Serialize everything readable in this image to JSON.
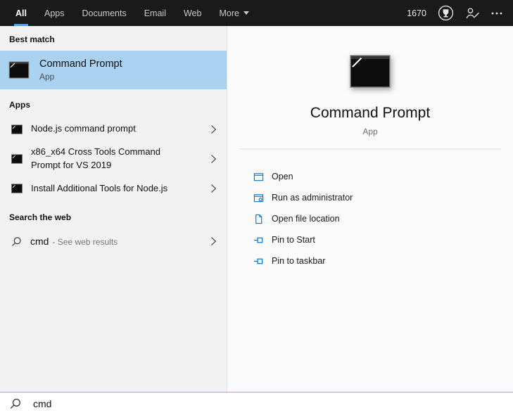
{
  "colors": {
    "topbar_bg": "#1a1a1a",
    "accent_blue": "#0078d7",
    "tab_underline": "#5ba0e0",
    "best_match_highlight": "#a8d2ef",
    "left_panel_bg": "#f2f2f2",
    "right_panel_bg": "#fafafa"
  },
  "topbar": {
    "tabs": [
      {
        "label": "All",
        "active": true
      },
      {
        "label": "Apps",
        "active": false
      },
      {
        "label": "Documents",
        "active": false
      },
      {
        "label": "Email",
        "active": false
      },
      {
        "label": "Web",
        "active": false
      },
      {
        "label": "More",
        "active": false,
        "has_dropdown": true
      }
    ],
    "points": "1670",
    "icons": [
      "rewards-icon",
      "feedback-icon",
      "more-options-icon"
    ]
  },
  "left_panel": {
    "best_match_header": "Best match",
    "best_match": {
      "title": "Command Prompt",
      "subtitle": "App",
      "icon": "command-prompt-icon"
    },
    "apps_header": "Apps",
    "apps": [
      {
        "label": "Node.js command prompt",
        "icon": "command-prompt-icon"
      },
      {
        "label": "x86_x64 Cross Tools Command Prompt for VS 2019",
        "icon": "command-prompt-icon"
      },
      {
        "label": "Install Additional Tools for Node.js",
        "icon": "command-prompt-icon"
      }
    ],
    "web_header": "Search the web",
    "web_item": {
      "query": "cmd",
      "suffix": "- See web results",
      "icon": "search-icon"
    }
  },
  "right_panel": {
    "title": "Command Prompt",
    "subtitle": "App",
    "icon": "command-prompt-icon",
    "actions": [
      {
        "label": "Open",
        "icon": "open-icon"
      },
      {
        "label": "Run as administrator",
        "icon": "run-as-admin-icon"
      },
      {
        "label": "Open file location",
        "icon": "file-location-icon"
      },
      {
        "label": "Pin to Start",
        "icon": "pin-icon"
      },
      {
        "label": "Pin to taskbar",
        "icon": "pin-icon"
      }
    ]
  },
  "search_bar": {
    "value": "cmd",
    "icon": "search-icon"
  }
}
